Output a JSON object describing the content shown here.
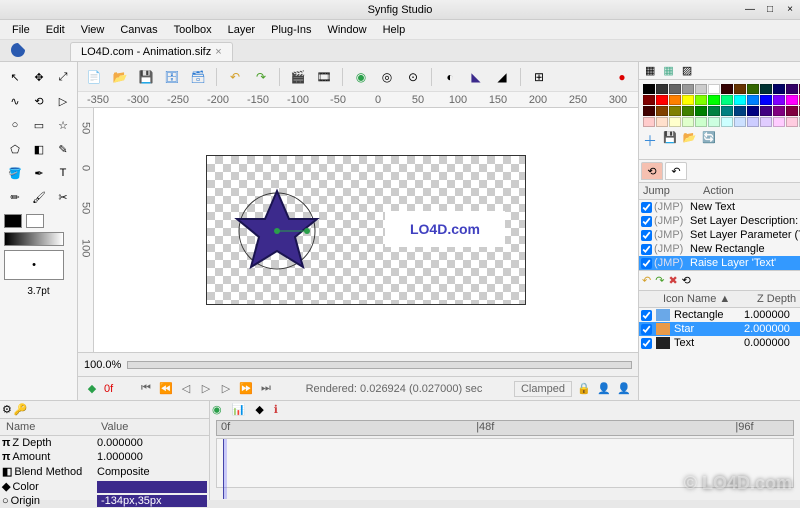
{
  "window": {
    "title": "Synfig Studio"
  },
  "menu": [
    "File",
    "Edit",
    "View",
    "Canvas",
    "Toolbox",
    "Layer",
    "Plug-Ins",
    "Window",
    "Help"
  ],
  "document": {
    "title": "LO4D.com - Animation.sifz"
  },
  "canvas_text": "LO4D.com",
  "ruler_h": [
    "-350",
    "-300",
    "-250",
    "-200",
    "-150",
    "-100",
    "-50",
    "0",
    "50",
    "100",
    "150",
    "200",
    "250",
    "300",
    "350"
  ],
  "ruler_v": [
    "50",
    "0",
    "50",
    "100"
  ],
  "toolbox": {
    "stroke_width": "3.7pt"
  },
  "zoom": "100.0%",
  "playback": {
    "frame": "0f",
    "status": "Rendered: 0.026924 (0.027000) sec",
    "interp": "Clamped"
  },
  "history": {
    "cols": [
      "Jump",
      "Action"
    ],
    "rows": [
      {
        "jump": "(JMP)",
        "action": "New Text",
        "sel": false
      },
      {
        "jump": "(JMP)",
        "action": "Set Layer Description: 'Text' -> 'Text'",
        "sel": false
      },
      {
        "jump": "(JMP)",
        "action": "Set Layer Parameter (Text):Origin",
        "sel": false
      },
      {
        "jump": "(JMP)",
        "action": "New Rectangle",
        "sel": false
      },
      {
        "jump": "(JMP)",
        "action": "Raise Layer 'Text'",
        "sel": true
      }
    ]
  },
  "layers": {
    "cols": [
      "Icon",
      "Name ▲",
      "Z Depth"
    ],
    "rows": [
      {
        "name": "Rectangle",
        "z": "1.000000",
        "sel": false,
        "color": "#6aa8e8"
      },
      {
        "name": "Star",
        "z": "2.000000",
        "sel": true,
        "color": "#e89a4a"
      },
      {
        "name": "Text",
        "z": "0.000000",
        "sel": false,
        "color": "#222"
      }
    ]
  },
  "params": {
    "cols": [
      "Name",
      "Value"
    ],
    "rows": [
      {
        "icon": "π",
        "name": "Z Depth",
        "value": "0.000000"
      },
      {
        "icon": "π",
        "name": "Amount",
        "value": "1.000000"
      },
      {
        "icon": "◧",
        "name": "Blend Method",
        "value": "Composite"
      },
      {
        "icon": "◆",
        "name": "Color",
        "value": "",
        "color": "#3c2a8c"
      },
      {
        "icon": "○",
        "name": "Origin",
        "value": "-134px,35px",
        "sel": true
      }
    ]
  },
  "timeline": {
    "marks": [
      "0f",
      "|48f",
      "|96f"
    ]
  },
  "palette": [
    "#000000",
    "#333333",
    "#666666",
    "#999999",
    "#cccccc",
    "#ffffff",
    "#330000",
    "#663300",
    "#336600",
    "#003333",
    "#000066",
    "#330066",
    "#660033",
    "#800000",
    "#ff0000",
    "#ff8000",
    "#ffff00",
    "#80ff00",
    "#00ff00",
    "#00ff80",
    "#00ffff",
    "#0080ff",
    "#0000ff",
    "#8000ff",
    "#ff00ff",
    "#ff0080",
    "#400000",
    "#804000",
    "#808000",
    "#408000",
    "#008000",
    "#008040",
    "#008080",
    "#004080",
    "#000080",
    "#400080",
    "#800080",
    "#800040",
    "#804040",
    "#ffcccc",
    "#ffe0cc",
    "#ffffcc",
    "#e0ffcc",
    "#ccffcc",
    "#ccffe0",
    "#ccffff",
    "#cce0ff",
    "#ccccff",
    "#e0ccff",
    "#ffccff",
    "#ffcce0",
    "#eeeeee"
  ],
  "watermark": "© LO4D.com"
}
